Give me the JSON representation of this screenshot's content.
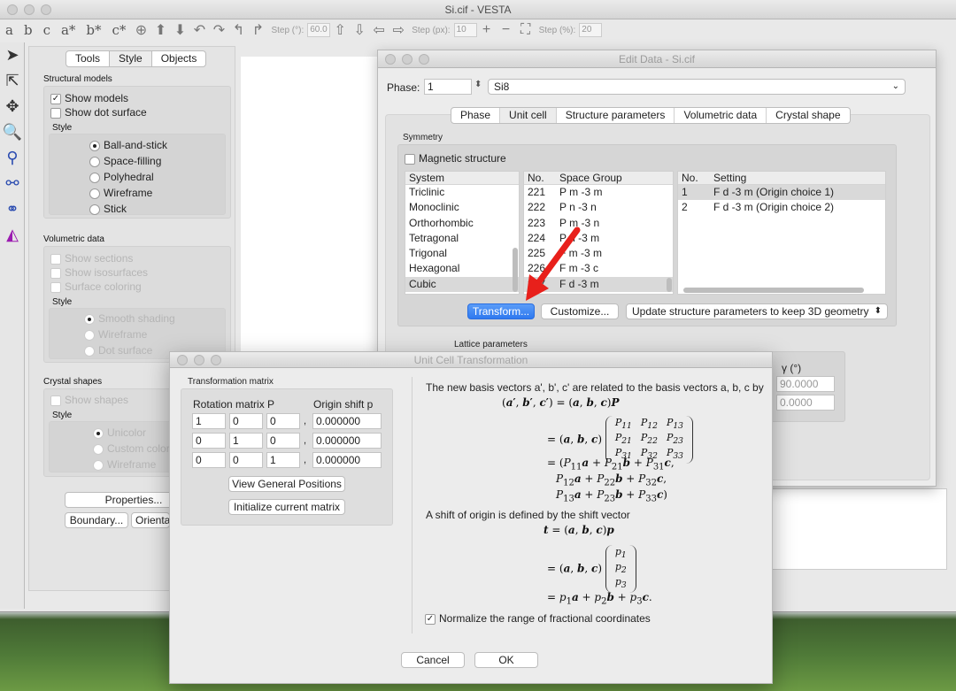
{
  "main_window": {
    "title": "Si.cif - VESTA"
  },
  "toolbar": {
    "letters": [
      "a",
      "b",
      "c",
      "a*",
      "b*",
      "c*"
    ],
    "step_deg_label": "Step (°):",
    "step_deg_value": "60.0",
    "step_px_label": "Step (px):",
    "step_px_value": "10",
    "step_pct_label": "Step (%):",
    "step_pct_value": "20"
  },
  "side_panel": {
    "tabs": [
      "Tools",
      "Style",
      "Objects"
    ],
    "structural_models": {
      "title": "Structural models",
      "show_models": "Show models",
      "show_dot_surface": "Show dot surface",
      "style_label": "Style",
      "styles": [
        "Ball-and-stick",
        "Space-filling",
        "Polyhedral",
        "Wireframe",
        "Stick"
      ],
      "selected_style": "Ball-and-stick"
    },
    "volumetric": {
      "title": "Volumetric data",
      "show_sections": "Show sections",
      "show_isosurfaces": "Show isosurfaces",
      "surface_coloring": "Surface coloring",
      "style_label": "Style",
      "styles": [
        "Smooth shading",
        "Wireframe",
        "Dot surface"
      ]
    },
    "crystal_shapes": {
      "title": "Crystal shapes",
      "show_shapes": "Show shapes",
      "style_label": "Style",
      "styles": [
        "Unicolor",
        "Custom color",
        "Wireframe"
      ]
    },
    "properties_btn": "Properties...",
    "boundary_btn": "Boundary...",
    "orientation_btn": "Orienta"
  },
  "edit_data": {
    "title": "Edit Data - Si.cif",
    "phase_label": "Phase:",
    "phase_value": "1",
    "phase_name": "Si8",
    "tabs": [
      "Phase",
      "Unit cell",
      "Structure parameters",
      "Volumetric data",
      "Crystal shape"
    ],
    "active_tab": "Unit cell",
    "symmetry_label": "Symmetry",
    "magnetic_label": "Magnetic structure",
    "system_header": "System",
    "systems": [
      "Triclinic",
      "Monoclinic",
      "Orthorhombic",
      "Tetragonal",
      "Trigonal",
      "Hexagonal",
      "Cubic"
    ],
    "sg_no_header": "No.",
    "sg_header": "Space Group",
    "space_groups": [
      {
        "no": "221",
        "name": "P m -3 m"
      },
      {
        "no": "222",
        "name": "P n -3 n"
      },
      {
        "no": "223",
        "name": "P m -3 n"
      },
      {
        "no": "224",
        "name": "P n -3 m"
      },
      {
        "no": "225",
        "name": "F m -3 m"
      },
      {
        "no": "226",
        "name": "F m -3 c"
      },
      {
        "no": "227",
        "name": "F d -3 m"
      }
    ],
    "set_no_header": "No.",
    "setting_header": "Setting",
    "settings": [
      {
        "no": "1",
        "name": "F d -3 m (Origin choice 1)"
      },
      {
        "no": "2",
        "name": "F d -3 m (Origin choice 2)"
      }
    ],
    "transform_btn": "Transform...",
    "customize_btn": "Customize...",
    "update_select": "Update structure parameters to keep 3D geometry",
    "lattice_label": "Lattice parameters",
    "gamma_label": "γ (°)",
    "gamma_value": "90.0000",
    "gamma_err": "0.0000"
  },
  "transform_dialog": {
    "title": "Unit Cell Transformation",
    "matrix_group": "Transformation matrix",
    "rotation_label": "Rotation matrix P",
    "origin_label": "Origin shift p",
    "rows": [
      {
        "p": [
          "1",
          "0",
          "0"
        ],
        "shift": "0.000000"
      },
      {
        "p": [
          "0",
          "1",
          "0"
        ],
        "shift": "0.000000"
      },
      {
        "p": [
          "0",
          "0",
          "1"
        ],
        "shift": "0.000000"
      }
    ],
    "view_btn": "View General Positions",
    "init_btn": "Initialize current matrix",
    "desc1": "The new basis vectors a', b', c' are related to the basis vectors a, b, c by",
    "desc2": "A shift of origin is defined by the shift vector",
    "normalize_label": "Normalize the range of fractional coordinates",
    "cancel_btn": "Cancel",
    "ok_btn": "OK"
  }
}
